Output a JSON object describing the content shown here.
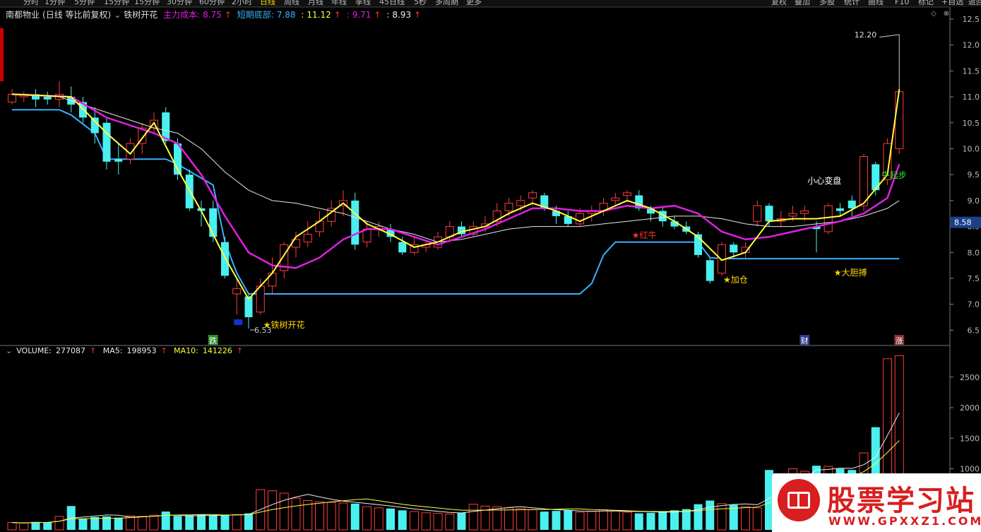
{
  "toolbar": {
    "timeframes": [
      "分时",
      "1分钟",
      "5分钟",
      "15分钟",
      "15分钟",
      "30分钟",
      "60分钟",
      "2小时",
      "日线",
      "周线",
      "月线",
      "年线",
      "季线",
      "45日线",
      "5秒",
      "多周期",
      "更多"
    ],
    "active_timeframe": "日线",
    "tools": [
      "复权",
      "叠加",
      "多股",
      "统计",
      "画线",
      "F10",
      "标记",
      "+自选",
      "返回"
    ]
  },
  "header": {
    "stock_name": "南都物业",
    "adjust": "(日线 等比前复权)",
    "indicator": "铁树开花",
    "main_cost_label": "主力成本:",
    "main_cost_value": "8.75",
    "short_bottom_label": "短期底部:",
    "short_bottom_value": "7.88",
    "v3": "11.12",
    "v4": "9.71",
    "v5": "8.93"
  },
  "volume_header": {
    "volume_label": "VOLUME:",
    "volume_value": "277087",
    "ma5_label": "MA5:",
    "ma5_value": "198953",
    "ma10_label": "MA10:",
    "ma10_value": "141226"
  },
  "annotations": {
    "high": "12.20",
    "low": "6.53",
    "a1": "★铁树开花",
    "a2": "★红牛",
    "a3": "★加仓",
    "a4": "★大胆搏",
    "a5": "小心变盘",
    "a6": "牛起步",
    "d1": "跌",
    "d2": "财",
    "d3": "涨",
    "current_price": "8.58"
  },
  "watermark": {
    "title": "股票学习站",
    "url": "WWW.GPXXZ1.COM"
  },
  "colors": {
    "up": "#ff3b3b",
    "down": "#4af0f0",
    "ma_yellow": "#ffff40",
    "ma_magenta": "#e020e0",
    "ma_white": "#e8e8e8",
    "support": "#3ab0ff"
  },
  "chart_data": {
    "type": "candlestick",
    "price_axis": [
      6.5,
      7.0,
      7.5,
      8.0,
      8.5,
      9.0,
      9.5,
      10.0,
      10.5,
      11.0,
      11.5,
      12.0,
      12.5
    ],
    "volume_axis": [
      1000,
      1500,
      2000,
      2500
    ],
    "ylim": [
      6.3,
      12.6
    ],
    "candles": [
      [
        10.9,
        11.05,
        11.15,
        10.85
      ],
      [
        11.0,
        11.05,
        11.1,
        10.9
      ],
      [
        11.05,
        10.95,
        11.15,
        10.8
      ],
      [
        11.0,
        10.95,
        11.1,
        10.85
      ],
      [
        10.95,
        11.05,
        11.3,
        10.8
      ],
      [
        11.0,
        10.85,
        11.2,
        10.7
      ],
      [
        10.9,
        10.6,
        11.0,
        10.5
      ],
      [
        10.6,
        10.3,
        10.8,
        10.1
      ],
      [
        10.5,
        9.75,
        10.6,
        9.6
      ],
      [
        9.8,
        9.75,
        10.1,
        9.5
      ],
      [
        9.8,
        10.1,
        10.2,
        9.7
      ],
      [
        10.1,
        10.4,
        10.5,
        9.9
      ],
      [
        10.4,
        10.55,
        10.7,
        10.3
      ],
      [
        10.7,
        10.15,
        10.8,
        10.1
      ],
      [
        10.1,
        9.5,
        10.2,
        9.4
      ],
      [
        9.5,
        8.85,
        9.6,
        8.8
      ],
      [
        8.85,
        8.8,
        9.0,
        8.5
      ],
      [
        8.85,
        8.3,
        9.0,
        8.2
      ],
      [
        8.2,
        7.55,
        8.3,
        7.5
      ],
      [
        7.2,
        7.3,
        7.5,
        6.8
      ],
      [
        7.15,
        6.75,
        7.2,
        6.53
      ],
      [
        6.85,
        7.35,
        7.5,
        6.8
      ],
      [
        7.35,
        7.6,
        7.9,
        7.2
      ],
      [
        7.65,
        8.15,
        8.2,
        7.5
      ],
      [
        8.1,
        8.25,
        8.4,
        7.9
      ],
      [
        8.2,
        8.35,
        8.6,
        8.1
      ],
      [
        8.4,
        8.6,
        8.8,
        8.3
      ],
      [
        8.6,
        8.85,
        9.0,
        8.5
      ],
      [
        8.9,
        9.0,
        9.2,
        8.7
      ],
      [
        9.0,
        8.15,
        9.15,
        8.05
      ],
      [
        8.2,
        8.45,
        8.6,
        8.1
      ],
      [
        8.45,
        8.5,
        8.6,
        8.3
      ],
      [
        8.45,
        8.3,
        8.55,
        8.2
      ],
      [
        8.2,
        8.0,
        8.3,
        7.95
      ],
      [
        8.0,
        8.15,
        8.3,
        7.95
      ],
      [
        8.1,
        8.15,
        8.25,
        8.0
      ],
      [
        8.1,
        8.3,
        8.4,
        8.05
      ],
      [
        8.3,
        8.5,
        8.6,
        8.2
      ],
      [
        8.5,
        8.35,
        8.6,
        8.3
      ],
      [
        8.35,
        8.5,
        8.6,
        8.3
      ],
      [
        8.5,
        8.55,
        8.7,
        8.4
      ],
      [
        8.6,
        8.8,
        8.95,
        8.5
      ],
      [
        8.8,
        8.95,
        9.05,
        8.7
      ],
      [
        8.9,
        9.0,
        9.1,
        8.8
      ],
      [
        9.05,
        9.15,
        9.2,
        8.9
      ],
      [
        9.1,
        8.85,
        9.15,
        8.8
      ],
      [
        8.8,
        8.7,
        8.9,
        8.55
      ],
      [
        8.7,
        8.55,
        8.8,
        8.5
      ],
      [
        8.55,
        8.75,
        8.85,
        8.5
      ],
      [
        8.75,
        8.8,
        8.9,
        8.6
      ],
      [
        8.8,
        8.95,
        9.05,
        8.7
      ],
      [
        9.0,
        9.05,
        9.15,
        8.9
      ],
      [
        9.1,
        9.15,
        9.2,
        8.95
      ],
      [
        9.1,
        8.85,
        9.2,
        8.8
      ],
      [
        8.85,
        8.75,
        8.9,
        8.6
      ],
      [
        8.8,
        8.6,
        8.9,
        8.5
      ],
      [
        8.6,
        8.5,
        8.7,
        8.45
      ],
      [
        8.5,
        8.4,
        8.6,
        8.35
      ],
      [
        8.35,
        7.95,
        8.4,
        7.9
      ],
      [
        7.85,
        7.45,
        7.9,
        7.4
      ],
      [
        7.6,
        8.15,
        8.2,
        7.55
      ],
      [
        8.15,
        8.0,
        8.2,
        7.9
      ],
      [
        8.0,
        8.1,
        8.2,
        7.9
      ],
      [
        8.6,
        8.9,
        9.0,
        8.5
      ],
      [
        8.9,
        8.6,
        8.95,
        8.5
      ],
      [
        8.6,
        8.65,
        8.8,
        8.5
      ],
      [
        8.7,
        8.75,
        8.9,
        8.6
      ],
      [
        8.75,
        8.8,
        8.9,
        8.6
      ],
      [
        8.5,
        8.45,
        8.6,
        8.0
      ],
      [
        8.4,
        8.9,
        8.95,
        8.35
      ],
      [
        8.85,
        8.8,
        8.95,
        8.7
      ],
      [
        9.0,
        8.85,
        9.1,
        8.7
      ],
      [
        8.9,
        9.85,
        9.9,
        8.8
      ],
      [
        9.7,
        9.2,
        9.75,
        9.1
      ],
      [
        9.4,
        10.1,
        10.2,
        9.3
      ],
      [
        10.0,
        11.1,
        11.1,
        9.9
      ]
    ],
    "volume": [
      120,
      110,
      130,
      125,
      220,
      390,
      180,
      210,
      220,
      200,
      230,
      220,
      240,
      300,
      230,
      240,
      250,
      240,
      250,
      250,
      270,
      660,
      640,
      600,
      520,
      480,
      460,
      450,
      440,
      430,
      380,
      360,
      350,
      320,
      300,
      280,
      270,
      260,
      280,
      420,
      390,
      380,
      360,
      350,
      330,
      300,
      310,
      320,
      290,
      300,
      330,
      310,
      290,
      270,
      280,
      300,
      320,
      340,
      420,
      480,
      430,
      410,
      380,
      360,
      980,
      900,
      1000,
      960,
      1050,
      1040,
      1000,
      980,
      1260,
      1680,
      2800,
      2850
    ],
    "ma_yellow": [
      [
        0,
        11.05
      ],
      [
        5,
        11.0
      ],
      [
        8,
        10.3
      ],
      [
        10,
        9.9
      ],
      [
        12,
        10.5
      ],
      [
        14,
        9.6
      ],
      [
        16,
        8.8
      ],
      [
        18,
        7.9
      ],
      [
        20,
        7.1
      ],
      [
        22,
        7.6
      ],
      [
        24,
        8.3
      ],
      [
        26,
        8.6
      ],
      [
        28,
        8.95
      ],
      [
        30,
        8.55
      ],
      [
        32,
        8.35
      ],
      [
        34,
        8.1
      ],
      [
        36,
        8.2
      ],
      [
        38,
        8.4
      ],
      [
        40,
        8.5
      ],
      [
        42,
        8.75
      ],
      [
        44,
        8.95
      ],
      [
        46,
        8.8
      ],
      [
        48,
        8.6
      ],
      [
        50,
        8.8
      ],
      [
        52,
        9.0
      ],
      [
        54,
        8.85
      ],
      [
        56,
        8.6
      ],
      [
        58,
        8.3
      ],
      [
        60,
        7.85
      ],
      [
        62,
        8.0
      ],
      [
        64,
        8.6
      ],
      [
        66,
        8.65
      ],
      [
        68,
        8.65
      ],
      [
        70,
        8.7
      ],
      [
        72,
        8.95
      ],
      [
        74,
        9.5
      ],
      [
        75,
        11.15
      ]
    ],
    "ma_magenta": [
      [
        0,
        11.05
      ],
      [
        5,
        11.0
      ],
      [
        8,
        10.6
      ],
      [
        12,
        10.3
      ],
      [
        14,
        10.1
      ],
      [
        16,
        9.5
      ],
      [
        18,
        8.7
      ],
      [
        20,
        8.0
      ],
      [
        22,
        7.75
      ],
      [
        24,
        7.7
      ],
      [
        26,
        7.9
      ],
      [
        28,
        8.25
      ],
      [
        30,
        8.45
      ],
      [
        32,
        8.45
      ],
      [
        34,
        8.3
      ],
      [
        36,
        8.15
      ],
      [
        38,
        8.3
      ],
      [
        40,
        8.45
      ],
      [
        42,
        8.65
      ],
      [
        44,
        8.85
      ],
      [
        46,
        8.85
      ],
      [
        48,
        8.8
      ],
      [
        50,
        8.8
      ],
      [
        52,
        8.9
      ],
      [
        54,
        8.85
      ],
      [
        56,
        8.9
      ],
      [
        58,
        8.75
      ],
      [
        60,
        8.4
      ],
      [
        62,
        8.25
      ],
      [
        64,
        8.3
      ],
      [
        66,
        8.4
      ],
      [
        68,
        8.5
      ],
      [
        70,
        8.6
      ],
      [
        72,
        8.75
      ],
      [
        74,
        9.05
      ],
      [
        75,
        9.7
      ]
    ],
    "ma_white": [
      [
        0,
        11.05
      ],
      [
        4,
        11.0
      ],
      [
        8,
        10.7
      ],
      [
        12,
        10.4
      ],
      [
        14,
        10.3
      ],
      [
        16,
        10.0
      ],
      [
        18,
        9.55
      ],
      [
        20,
        9.2
      ],
      [
        22,
        9.0
      ],
      [
        24,
        8.95
      ],
      [
        26,
        8.85
      ],
      [
        28,
        8.75
      ],
      [
        30,
        8.6
      ],
      [
        32,
        8.45
      ],
      [
        34,
        8.35
      ],
      [
        36,
        8.2
      ],
      [
        38,
        8.25
      ],
      [
        40,
        8.35
      ],
      [
        42,
        8.45
      ],
      [
        44,
        8.5
      ],
      [
        46,
        8.5
      ],
      [
        48,
        8.5
      ],
      [
        50,
        8.55
      ],
      [
        52,
        8.6
      ],
      [
        54,
        8.65
      ],
      [
        56,
        8.7
      ],
      [
        58,
        8.7
      ],
      [
        60,
        8.65
      ],
      [
        62,
        8.55
      ],
      [
        64,
        8.5
      ],
      [
        66,
        8.5
      ],
      [
        68,
        8.55
      ],
      [
        70,
        8.6
      ],
      [
        72,
        8.7
      ],
      [
        74,
        8.85
      ],
      [
        75,
        9.0
      ]
    ],
    "support": [
      [
        0,
        10.75
      ],
      [
        4,
        10.75
      ],
      [
        5,
        10.65
      ],
      [
        7,
        10.3
      ],
      [
        8,
        9.8
      ],
      [
        13,
        9.8
      ],
      [
        14,
        9.7
      ],
      [
        17,
        9.3
      ],
      [
        18,
        8.2
      ],
      [
        19,
        7.6
      ],
      [
        20,
        7.2
      ],
      [
        48,
        7.2
      ],
      [
        49,
        7.4
      ],
      [
        50,
        7.95
      ],
      [
        51,
        8.2
      ],
      [
        58,
        8.2
      ],
      [
        59,
        7.9
      ],
      [
        60,
        7.88
      ],
      [
        75,
        7.88
      ]
    ]
  }
}
